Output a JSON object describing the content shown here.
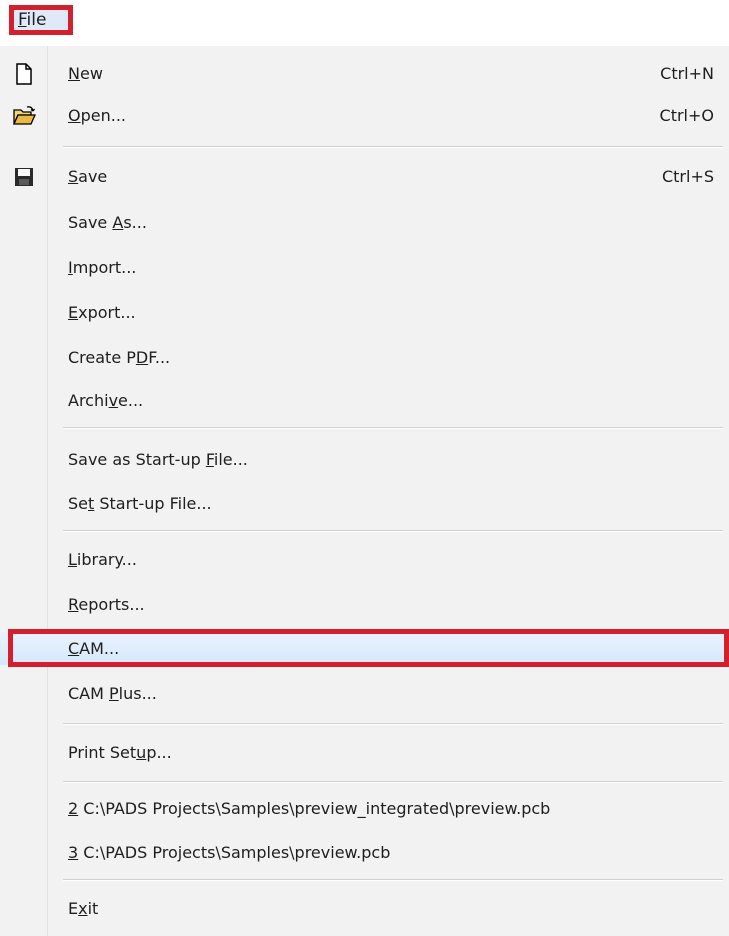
{
  "menubar": {
    "file_title": "File",
    "file_title_rest": "ile",
    "file_title_mnemonic": "F"
  },
  "items": [
    {
      "id": "new",
      "pre": "",
      "mn": "N",
      "post": "ew",
      "shortcut": "Ctrl+N",
      "icon": "new-file-icon"
    },
    {
      "id": "open",
      "pre": "",
      "mn": "O",
      "post": "pen...",
      "shortcut": "Ctrl+O",
      "icon": "open-folder-icon"
    },
    {
      "id": "save",
      "pre": "",
      "mn": "S",
      "post": "ave",
      "shortcut": "Ctrl+S",
      "icon": "floppy-disk-icon"
    },
    {
      "id": "save-as",
      "pre": "Save ",
      "mn": "A",
      "post": "s...",
      "shortcut": ""
    },
    {
      "id": "import",
      "pre": "",
      "mn": "I",
      "post": "mport...",
      "shortcut": ""
    },
    {
      "id": "export",
      "pre": "",
      "mn": "E",
      "post": "xport...",
      "shortcut": ""
    },
    {
      "id": "create-pdf",
      "pre": "Create P",
      "mn": "D",
      "post": "F...",
      "shortcut": ""
    },
    {
      "id": "archive",
      "pre": "Archi",
      "mn": "v",
      "post": "e...",
      "shortcut": ""
    },
    {
      "id": "save-startup",
      "pre": "Save as Start-up ",
      "mn": "F",
      "post": "ile...",
      "shortcut": ""
    },
    {
      "id": "set-startup",
      "pre": "Se",
      "mn": "t",
      "post": " Start-up File...",
      "shortcut": ""
    },
    {
      "id": "library",
      "pre": "",
      "mn": "L",
      "post": "ibrary...",
      "shortcut": ""
    },
    {
      "id": "reports",
      "pre": "",
      "mn": "R",
      "post": "eports...",
      "shortcut": ""
    },
    {
      "id": "cam",
      "pre": "",
      "mn": "C",
      "post": "AM...",
      "shortcut": ""
    },
    {
      "id": "cam-plus",
      "pre": "CAM ",
      "mn": "P",
      "post": "lus...",
      "shortcut": ""
    },
    {
      "id": "print-setup",
      "pre": "Print Set",
      "mn": "u",
      "post": "p...",
      "shortcut": ""
    },
    {
      "id": "recent-2",
      "pre": "",
      "mn": "2",
      "post": " C:\\PADS Projects\\Samples\\preview_integrated\\preview.pcb",
      "shortcut": ""
    },
    {
      "id": "recent-3",
      "pre": "",
      "mn": "3",
      "post": " C:\\PADS Projects\\Samples\\preview.pcb",
      "shortcut": ""
    },
    {
      "id": "exit",
      "pre": "E",
      "mn": "x",
      "post": "it",
      "shortcut": ""
    }
  ],
  "highlight_color": "#d4202d"
}
